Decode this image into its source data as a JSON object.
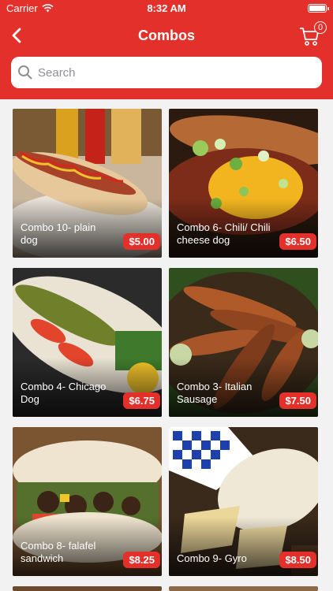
{
  "status": {
    "carrier": "Carrier",
    "time": "8:32 AM"
  },
  "nav": {
    "title": "Combos",
    "cart_count": "0"
  },
  "search": {
    "placeholder": "Search",
    "value": ""
  },
  "combos": [
    {
      "name": "Combo 10- plain dog",
      "price": "$5.00"
    },
    {
      "name": "Combo 6- Chili/ Chili cheese dog",
      "price": "$6.50"
    },
    {
      "name": "Combo 4- Chicago Dog",
      "price": "$6.75"
    },
    {
      "name": "Combo 3- Italian Sausage",
      "price": "$7.50"
    },
    {
      "name": "Combo 8- falafel sandwich",
      "price": "$8.25"
    },
    {
      "name": "Combo 9- Gyro",
      "price": "$8.50"
    }
  ],
  "colors": {
    "brand_red": "#e3302b"
  }
}
